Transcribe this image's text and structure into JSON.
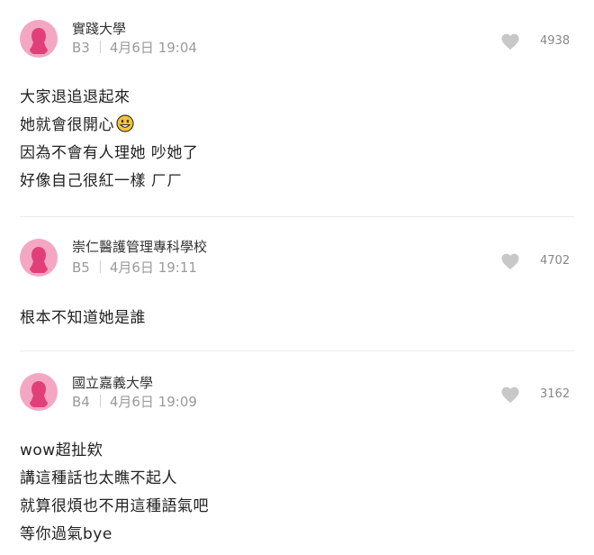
{
  "comments": [
    {
      "school": "實踐大學",
      "floor": "B3",
      "date": "4月6日 19:04",
      "likes": "4938",
      "lines": [
        "大家退追退起來",
        "她就會很開心",
        "因為不會有人理她 吵她了",
        "好像自己很紅一樣 ㄏㄏ"
      ],
      "emoji_after_line": 1,
      "emoji": "smiley-face-icon"
    },
    {
      "school": "崇仁醫護管理專科學校",
      "floor": "B5",
      "date": "4月6日 19:11",
      "likes": "4702",
      "lines": [
        "根本不知道她是誰"
      ]
    },
    {
      "school": "國立嘉義大學",
      "floor": "B4",
      "date": "4月6日 19:09",
      "likes": "3162",
      "lines": [
        "wow超扯欸",
        "講這種話也太瞧不起人",
        "就算很煩也不用這種語氣吧",
        "等你過氣bye"
      ]
    }
  ],
  "colors": {
    "avatar": "#f3a7c3",
    "avatar_silhouette": "#e23f78",
    "heart": "#c8c8c8",
    "meta_text": "#9a9a9a"
  }
}
